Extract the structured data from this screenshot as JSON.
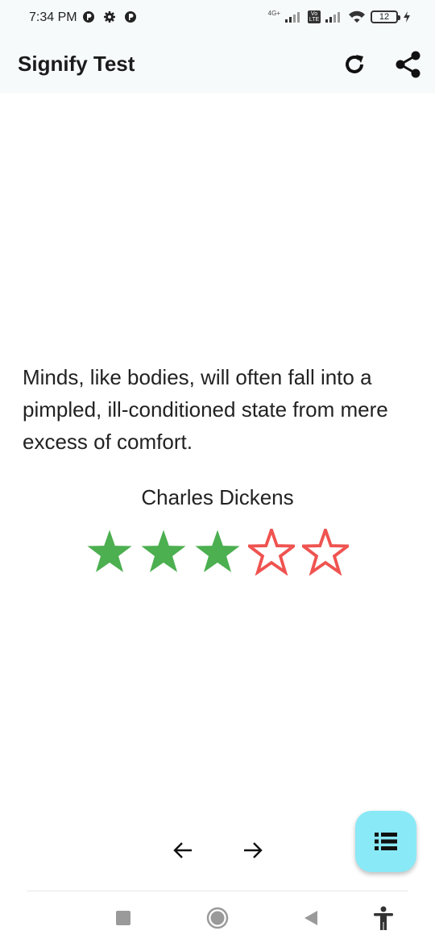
{
  "status_bar": {
    "time": "7:34 PM",
    "network_label": "4G+",
    "volte_label": "Vo LTE",
    "battery_level": "12",
    "icons": [
      "notification-icon",
      "settings-icon",
      "notification-icon",
      "signal-icon",
      "signal-icon",
      "wifi-icon",
      "battery-icon",
      "charging-icon"
    ]
  },
  "app_bar": {
    "title": "Signify Test",
    "actions": [
      "refresh-icon",
      "share-icon"
    ]
  },
  "quote": {
    "text": "Minds, like bodies, will often fall into a pimpled, ill-conditioned state from mere excess of comfort.",
    "author": "Charles Dickens"
  },
  "rating": {
    "value": 3,
    "max": 5,
    "filled_color": "#4caf50",
    "empty_color": "#ef5350"
  },
  "navigation": {
    "previous": "arrow-back-icon",
    "next": "arrow-forward-icon"
  },
  "fab": {
    "icon": "list-icon",
    "color": "#8ae9f7"
  },
  "system_nav": {
    "buttons": [
      "recents-icon",
      "home-icon",
      "back-icon",
      "accessibility-icon"
    ]
  }
}
